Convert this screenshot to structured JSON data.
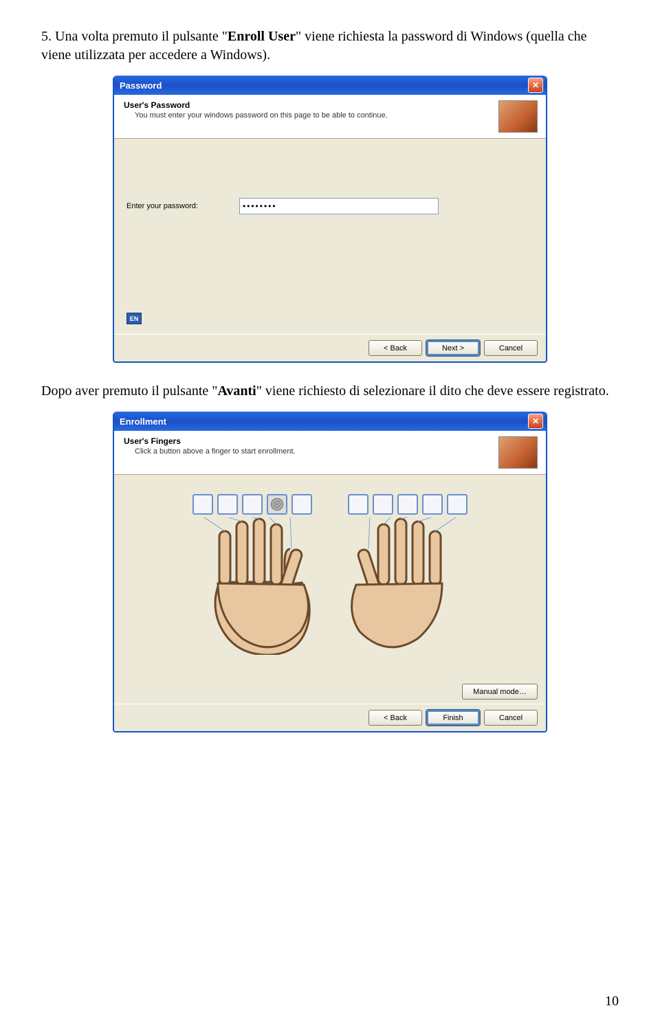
{
  "page": {
    "p1_prefix": "5. Una volta premuto il pulsante \"",
    "p1_bold": "Enroll User",
    "p1_suffix": "\" viene richiesta la password di Windows (quella che viene utilizzata per accedere a Windows).",
    "p2_prefix": "Dopo aver premuto il pulsante \"",
    "p2_bold": "Avanti",
    "p2_suffix": "\" viene richiesto di selezionare il dito che deve essere registrato.",
    "page_number": "10"
  },
  "dialog1": {
    "title": "Password",
    "header_title": "User's Password",
    "header_sub": "You must enter your windows password on this page to be able to continue.",
    "pwd_label": "Enter your password:",
    "pwd_value": "••••••••",
    "lang": "EN",
    "btn_back": "< Back",
    "btn_next": "Next >",
    "btn_cancel": "Cancel"
  },
  "dialog2": {
    "title": "Enrollment",
    "header_title": "User's Fingers",
    "header_sub": "Click a button above a finger to start enrollment.",
    "btn_manual": "Manual mode…",
    "btn_back": "< Back",
    "btn_finish": "Finish",
    "btn_cancel": "Cancel"
  }
}
